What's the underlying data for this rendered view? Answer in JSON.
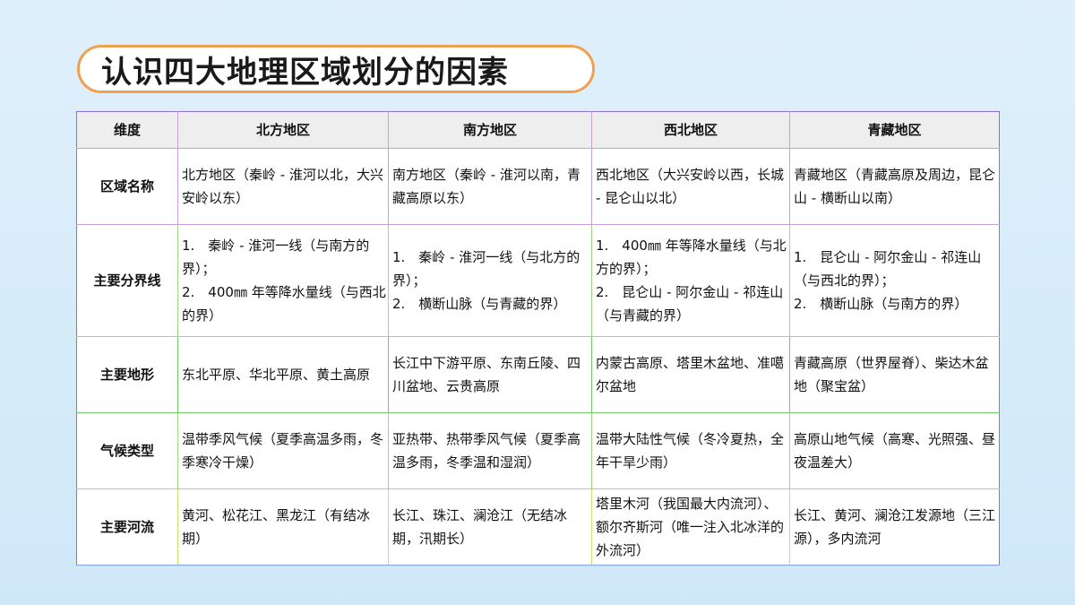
{
  "title": "认识四大地理区域划分的因素",
  "colors": {
    "title_border": "#f0a050",
    "header_bg": "#eeeeee",
    "background": "#dff0fb"
  },
  "table": {
    "headers": [
      "维度",
      "北方地区",
      "南方地区",
      "西北地区",
      "青藏地区"
    ],
    "rows": [
      {
        "dimension": "区域名称",
        "cells": [
          "北方地区（秦岭 - 淮河以北，大兴安岭以东）",
          "南方地区（秦岭 - 淮河以南，青藏高原以东）",
          "西北地区（大兴安岭以西，长城 - 昆仑山以北）",
          "青藏地区（青藏高原及周边，昆仑山 - 横断山以南）"
        ]
      },
      {
        "dimension": "主要分界线",
        "lists": [
          [
            "1.　秦岭 - 淮河一线（与南方的界）；",
            "2.　400㎜ 年等降水量线（与西北的界）"
          ],
          [
            "1.　秦岭 - 淮河一线（与北方的界）；",
            "2.　横断山脉（与青藏的界）"
          ],
          [
            "1.　400㎜ 年等降水量线（与北方的界）；",
            "2.　昆仑山 - 阿尔金山 - 祁连山（与青藏的界）"
          ],
          [
            "1.　昆仑山 - 阿尔金山 - 祁连山（与西北的界）；",
            "2.　横断山脉（与南方的界）"
          ]
        ]
      },
      {
        "dimension": "主要地形",
        "cells": [
          "东北平原、华北平原、黄土高原",
          "长江中下游平原、东南丘陵、四川盆地、云贵高原",
          "内蒙古高原、塔里木盆地、准噶尔盆地",
          "青藏高原（世界屋脊）、柴达木盆地（聚宝盆）"
        ]
      },
      {
        "dimension": "气候类型",
        "cells": [
          "温带季风气候（夏季高温多雨，冬季寒冷干燥）",
          "亚热带、热带季风气候（夏季高温多雨，冬季温和湿润）",
          "温带大陆性气候（冬冷夏热，全年干旱少雨）",
          "高原山地气候（高寒、光照强、昼夜温差大）"
        ]
      },
      {
        "dimension": "主要河流",
        "cells": [
          "黄河、松花江、黑龙江（有结冰期）",
          "长江、珠江、澜沧江（无结冰期，汛期长）",
          "塔里木河（我国最大内流河）、额尔齐斯河（唯一注入北冰洋的外流河）",
          "长江、黄河、澜沧江发源地（三江源），多内流河"
        ]
      }
    ]
  }
}
